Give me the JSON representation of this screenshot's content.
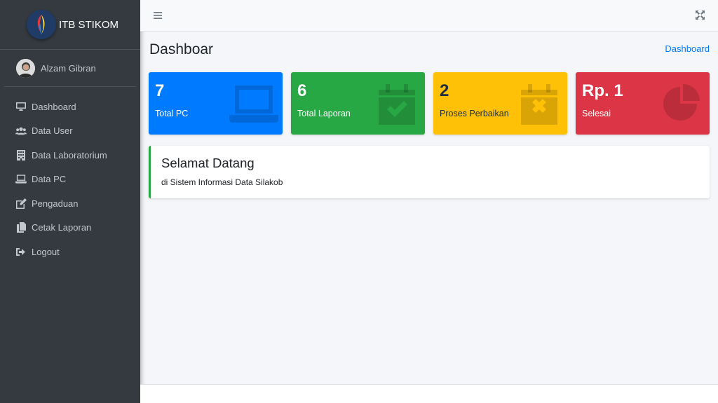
{
  "brand": {
    "name": "ITB STIKOM"
  },
  "user": {
    "name": "Alzam Gibran"
  },
  "sidebar": {
    "items": [
      {
        "label": "Dashboard",
        "icon": "desktop-icon"
      },
      {
        "label": "Data User",
        "icon": "users-icon"
      },
      {
        "label": "Data Laboratorium",
        "icon": "building-icon"
      },
      {
        "label": "Data PC",
        "icon": "laptop-icon"
      },
      {
        "label": "Pengaduan",
        "icon": "edit-icon"
      },
      {
        "label": "Cetak Laporan",
        "icon": "copy-icon"
      },
      {
        "label": "Logout",
        "icon": "sign-out-icon"
      }
    ]
  },
  "header": {
    "title": "Dashboar",
    "breadcrumb": "Dashboard"
  },
  "cards": [
    {
      "value": "7",
      "label": "Total PC",
      "color": "#007bff",
      "text_color": "#ffffff",
      "icon": "laptop-icon"
    },
    {
      "value": "6",
      "label": "Total Laporan",
      "color": "#28a745",
      "text_color": "#ffffff",
      "icon": "calendar-check-icon"
    },
    {
      "value": "2",
      "label": "Proses Perbaikan",
      "color": "#ffc107",
      "text_color": "#1f2d3d",
      "icon": "calendar-times-icon"
    },
    {
      "value": "Rp. 1",
      "label": "Selesai",
      "color": "#dc3545",
      "text_color": "#ffffff",
      "icon": "pie-chart-icon"
    }
  ],
  "welcome": {
    "title": "Selamat Datang",
    "subtitle": "di Sistem Informasi Data Silakob"
  }
}
